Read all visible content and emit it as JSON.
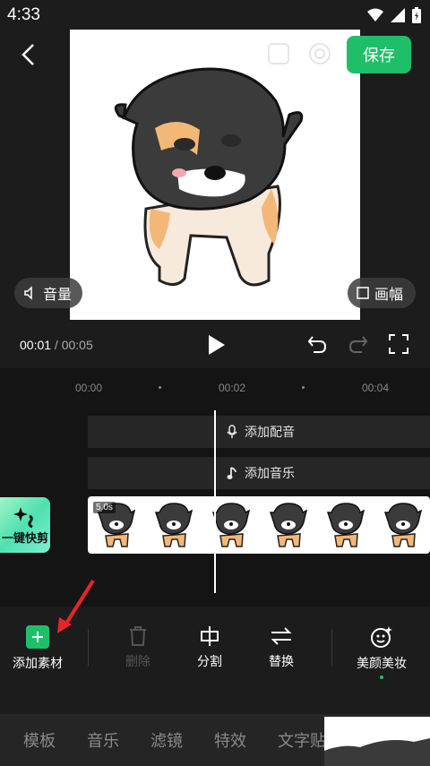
{
  "status": {
    "time": "4:33"
  },
  "header": {
    "save_label": "保存"
  },
  "preview": {
    "volume_label": "音量",
    "canvas_label": "画幅"
  },
  "playback": {
    "current": "00:01",
    "separator": " / ",
    "total": "00:05"
  },
  "ruler": {
    "marks": [
      "00:00",
      "00:02",
      "00:04"
    ]
  },
  "tracks": {
    "dubbing_label": "添加配音",
    "music_label": "添加音乐"
  },
  "clip": {
    "duration": "5.0s",
    "thumb_count": 6
  },
  "quick_cut": {
    "label": "一键快剪"
  },
  "toolbar": {
    "add_material": "添加素材",
    "delete": "删除",
    "split": "分割",
    "replace": "替换",
    "beauty": "美颜美妆"
  },
  "bottom_tabs": [
    "模板",
    "音乐",
    "滤镜",
    "特效",
    "文字贴"
  ],
  "colors": {
    "accent": "#1fbf6a",
    "annotation_arrow": "#e8232a"
  },
  "icons": [
    "back-arrow-icon",
    "play-icon",
    "undo-icon",
    "redo-icon",
    "fullscreen-icon",
    "mic-icon",
    "music-note-icon",
    "speaker-icon",
    "square-icon",
    "plus-icon",
    "trash-icon",
    "split-icon",
    "swap-icon",
    "face-sparkle-icon"
  ]
}
